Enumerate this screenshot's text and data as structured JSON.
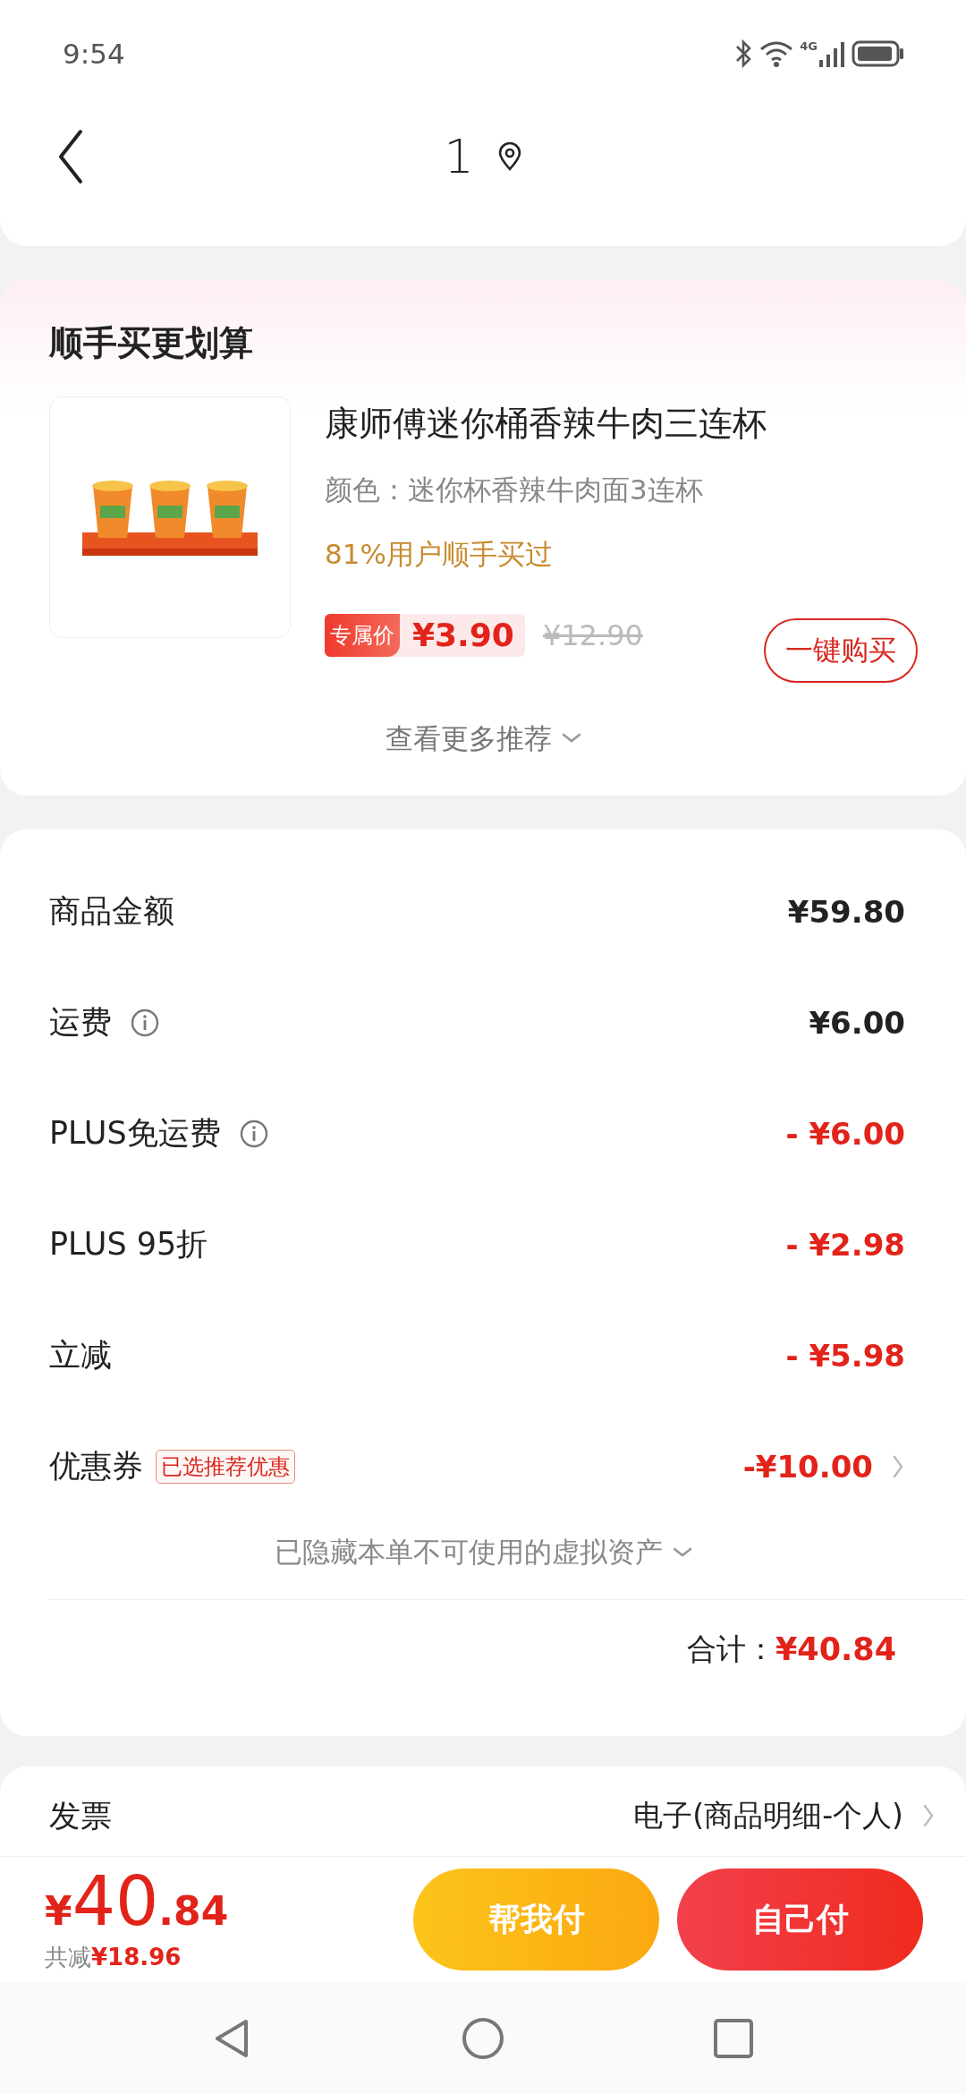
{
  "status_bar": {
    "time": "9:54",
    "network": "4G"
  },
  "header": {
    "title": "1"
  },
  "recommend": {
    "title": "顺手买更划算",
    "product": {
      "kind": "picture",
      "name": "康师傅迷你桶香辣牛肉三连杯",
      "variant": "颜色：迷你杯香辣牛肉面3连杯",
      "social_proof": "81%用户顺手买过",
      "price_tag": "专属价",
      "price": "¥3.90",
      "original_price": "¥12.90",
      "buy_button": "一键购买"
    },
    "more": "查看更多推荐"
  },
  "summary": {
    "rows": [
      {
        "label": "商品金额",
        "value": "¥59.80",
        "info": false,
        "discount": false
      },
      {
        "label": "运费",
        "value": "¥6.00",
        "info": true,
        "discount": false
      },
      {
        "label": "PLUS免运费",
        "value": "- ¥6.00",
        "info": true,
        "discount": true
      },
      {
        "label": "PLUS 95折",
        "value": "- ¥2.98",
        "info": false,
        "discount": true
      },
      {
        "label": "立减",
        "value": "- ¥5.98",
        "info": false,
        "discount": true
      },
      {
        "label": "优惠券",
        "badge": "已选推荐优惠",
        "value": "-¥10.00",
        "info": false,
        "discount": true,
        "chevron": true
      }
    ],
    "hidden_note": "已隐藏本单不可使用的虚拟资产",
    "total_label": "合计：",
    "total": "¥40.84"
  },
  "invoice": {
    "label": "发票",
    "value": "电子(商品明细-个人)"
  },
  "footer": {
    "currency": "¥",
    "price_int": "40",
    "price_dec": ".84",
    "saved_label": "共减",
    "saved": "¥18.96",
    "buttons": [
      {
        "label": "帮我付",
        "kind": "secondary"
      },
      {
        "label": "自己付",
        "kind": "primary"
      }
    ]
  }
}
